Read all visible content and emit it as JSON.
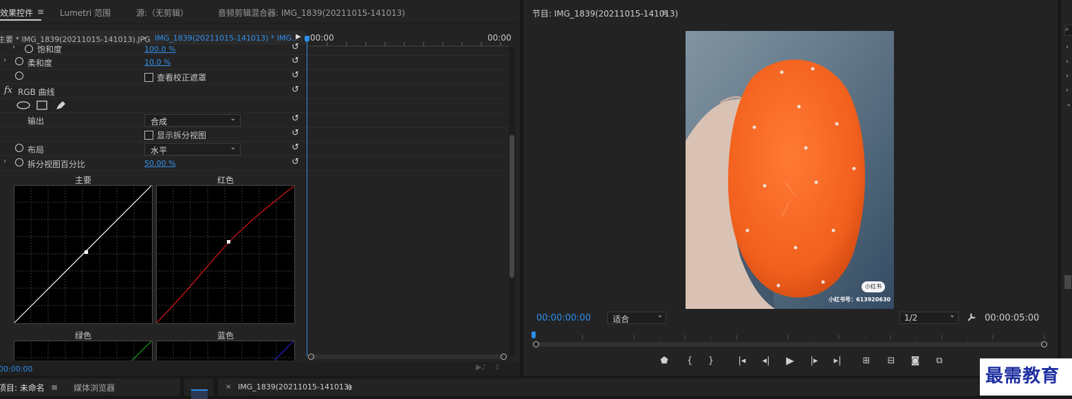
{
  "effect_controls": {
    "tabs": [
      {
        "label": "效果控件",
        "active": true
      },
      {
        "label": "Lumetri 范围",
        "active": false
      },
      {
        "label": "源:（无剪辑）",
        "active": false
      },
      {
        "label": "音频剪辑混合器: IMG_1839(20211015-141013)",
        "active": false
      }
    ],
    "master_clip": "主要 * IMG_1839(20211015-141013).JPG",
    "sequence_clip": "IMG_1839(20211015-141013) * IMG...",
    "timeline_start": "00:00",
    "timeline_end": "00:00",
    "properties": [
      {
        "label": "饱和度",
        "value": "100.0 %"
      },
      {
        "label": "柔和度",
        "value": "10.0 %"
      },
      {
        "label": "查看校正遮罩"
      },
      {
        "label": "RGB 曲线"
      },
      {
        "label": "输出",
        "value": "合成"
      },
      {
        "label": "显示拆分视图"
      },
      {
        "label": "布局",
        "value": "水平"
      },
      {
        "label": "拆分视图百分比",
        "value": "50.00 %"
      }
    ],
    "curves": [
      {
        "label": "主要",
        "color": "#ffffff"
      },
      {
        "label": "红色",
        "color": "#e01515"
      },
      {
        "label": "绿色",
        "color": "#1aa31a"
      },
      {
        "label": "蓝色",
        "color": "#2323d8"
      }
    ],
    "bottom_timecode": "00:00:00"
  },
  "program_monitor": {
    "title": "节目: IMG_1839(20211015-141013)",
    "image_text": {
      "badge": "小红书",
      "id_line": "小红书号：613920630"
    },
    "current_timecode": "00:00:00:00",
    "fit_label": "适合",
    "resolution": "1/2",
    "duration": "00:00:05:00"
  },
  "bottom": {
    "project_tab": "项目: 未命名",
    "media_browser_tab": "媒体浏览器",
    "sequence_tab": "IMG_1839(20211015-141013)"
  },
  "watermark": "最需教育"
}
